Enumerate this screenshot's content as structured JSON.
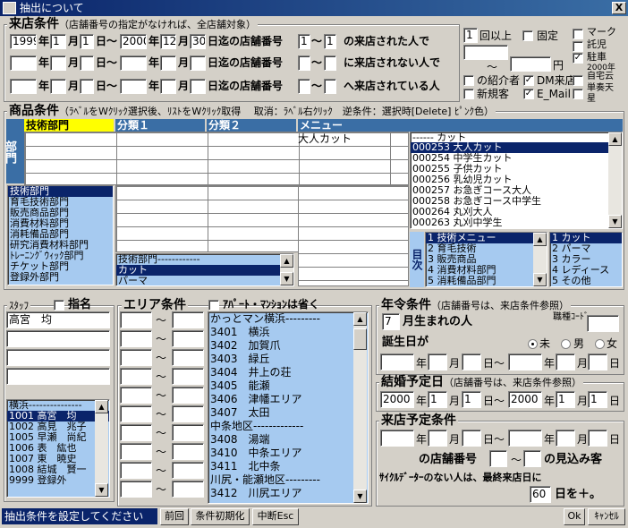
{
  "window": {
    "title": "抽出について",
    "close_label": "X"
  },
  "raiten": {
    "title": "来店条件",
    "note": "（店舗番号の指定がなければ、全店舗対象）",
    "row1": {
      "y1": "1999",
      "m1": "1",
      "d1": "1",
      "y2": "2000",
      "m2": "12",
      "d2": "30",
      "s1": "1",
      "s2": "1",
      "suffix": "の来店された人で"
    },
    "row2_suffix": "に来店されない人で",
    "row3_suffix": "へ来店されている人",
    "lbl_year": "年",
    "lbl_month": "月",
    "lbl_day_from": "日〜",
    "lbl_day": "日",
    "lbl_upto": "日迄の店舗番号",
    "lbl_tilde": "〜",
    "count": {
      "value": "1",
      "label": "回以上"
    },
    "kotei": "固定",
    "tilde2": "〜",
    "yen": "円",
    "shokai": "の紹介者",
    "dm": "DM来店",
    "shinki": "新規客",
    "email": "E_Mail",
    "side_options": [
      "マーク",
      "託児",
      "駐車",
      "2000年",
      "自宅云",
      "単奏天",
      "星"
    ]
  },
  "shohin": {
    "title": "商品条件",
    "help": "（ﾗﾍﾞﾙをWｸﾘｯｸ選択後、ﾘｽﾄをWｸﾘｯｸ取得　 取消：ﾗﾍﾞﾙ右ｸﾘｯｸ　逆条件：選択時[Delete] ﾋﾟﾝｸ色）",
    "side": "部門",
    "headers": {
      "col1": "技術部門",
      "col2": "分類１",
      "col3": "分類２",
      "col4": "メニュー"
    },
    "menu_first": "大人カット",
    "bumon_list": [
      "技術部門",
      "育毛技術部門",
      "販売商品部門",
      "消費材料部門",
      "消耗備品部門",
      "研究消費材料部門",
      "ﾄﾚｰﾆﾝｸﾞｳｨｯｸ部門",
      "チケット部門",
      "登録外部門"
    ],
    "bunrui_list": [
      "技術部門------------",
      "カット",
      "パーマ"
    ],
    "cut_header": "------ カット",
    "cut_list": [
      {
        "code": "000253",
        "name": "大人カット"
      },
      {
        "code": "000254",
        "name": "中学生カット"
      },
      {
        "code": "000255",
        "name": "子供カット"
      },
      {
        "code": "000256",
        "name": "乳幼児カット"
      },
      {
        "code": "000257",
        "name": "お急ぎコース大人"
      },
      {
        "code": "000258",
        "name": "お急ぎコース中学生"
      },
      {
        "code": "000264",
        "name": "丸刈大人"
      },
      {
        "code": "000263",
        "name": "丸刈中学生"
      }
    ],
    "moku_label": "目次",
    "moku_list": [
      "1 技術メニュー",
      "2 育毛技術",
      "3 販売商品",
      "4 消費材料部門",
      "5 消耗備品部門"
    ],
    "sub_list": [
      "1 カット",
      "2 パーマ",
      "3 カラー",
      "4 レディース",
      "5 その他"
    ]
  },
  "staff": {
    "title": "ｽﾀｯﾌ",
    "shimei": "指名",
    "first": "高宮　均",
    "list_header": "横浜---------------",
    "list": [
      "1001 高宮　均",
      "1002 高見　兆子",
      "1005 早瀬　尚紀",
      "1006 表　紘也",
      "1007 東　暁史",
      "1008 結城　賢一",
      "9999 登録外"
    ]
  },
  "area": {
    "title": "エリア条件",
    "apart": "ｱﾊﾟｰﾄ・ﾏﾝｼｮﾝは省く",
    "tilde": "〜",
    "list": [
      "かっとマン横浜---------",
      "3401　横浜",
      "3402　加賀爪",
      "3403　緑丘",
      "3404　井上の荘",
      "3405　能瀬",
      "3406　津幡エリア",
      "3407　太田",
      "中条地区-------------",
      "3408　湯端",
      "3410　中条エリア",
      "3411　北中条",
      "川尻・能瀬地区---------",
      "3412　川尻エリア"
    ]
  },
  "nenrei": {
    "title": "年令条件",
    "note": "（店舗番号は、来店条件参照）",
    "month": "7",
    "month_label": "月生まれの人",
    "shokuin": "職種ｺｰﾄﾞ",
    "birthday": "誕生日が",
    "sex": {
      "unknown": "未",
      "male": "男",
      "female": "女"
    },
    "lbl_year": "年",
    "lbl_month": "月",
    "lbl_day_from": "日〜",
    "lbl_day": "日"
  },
  "kekkon": {
    "title": "結婚予定日",
    "note": "（店舗番号は、来店条件参照）",
    "y1": "2000",
    "m1": "1",
    "d1": "1",
    "y2": "2000",
    "m2": "1",
    "d2": "1",
    "lbl_year": "年",
    "lbl_month": "月",
    "lbl_day_from": "日〜",
    "lbl_day": "日"
  },
  "yotei": {
    "title": "来店予定条件",
    "lbl_year": "年",
    "lbl_month": "月",
    "lbl_day_from": "日〜",
    "lbl_day": "日",
    "store_label": "の店舗番号",
    "tilde": "〜",
    "mikomi": "の見込み客",
    "cycle_note": "ｻｲｸﾙﾃﾞｰﾀｰのない人は、最終来店日に",
    "days": "60",
    "days_suffix": "日を＋。"
  },
  "footer": {
    "status": "抽出条件を設定してください",
    "prev": "前回",
    "init": "条件初期化",
    "abort": "中断Esc",
    "ok": "Ok",
    "cancel": "ｷｬﾝｾﾙ"
  }
}
